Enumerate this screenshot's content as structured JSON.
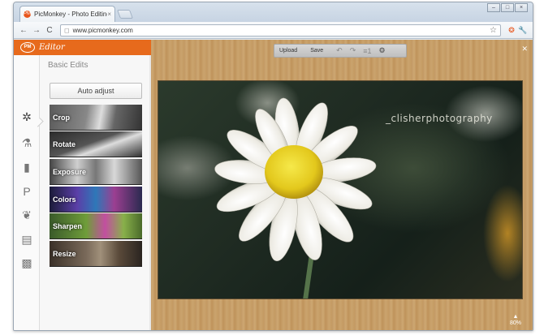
{
  "browser": {
    "tab_title": "PicMonkey - Photo Editing",
    "tab_close": "×",
    "favicon_label": "PM",
    "window_controls": [
      "–",
      "□",
      "×"
    ],
    "url": "www.picmonkey.com",
    "nav": {
      "back": "←",
      "forward": "→",
      "reload": "C"
    }
  },
  "editor": {
    "title": "Editor",
    "logo_label": "PM",
    "section_title": "Basic Edits",
    "auto_adjust_label": "Auto adjust",
    "tiles": [
      {
        "label": "Crop"
      },
      {
        "label": "Rotate"
      },
      {
        "label": "Exposure"
      },
      {
        "label": "Colors"
      },
      {
        "label": "Sharpen"
      },
      {
        "label": "Resize"
      }
    ],
    "tools": [
      "basic-edits-icon",
      "effects-flask-icon",
      "touch-up-brush-icon",
      "text-icon",
      "overlays-butterfly-icon",
      "frames-icon",
      "textures-icon"
    ]
  },
  "actionbar": {
    "upload_label": "Upload",
    "save_label": "Save",
    "history_count": "1"
  },
  "photo": {
    "watermark": "_clisherphotography"
  },
  "zoom_label": "80%",
  "colors": {
    "accent": "#e76a1c"
  }
}
